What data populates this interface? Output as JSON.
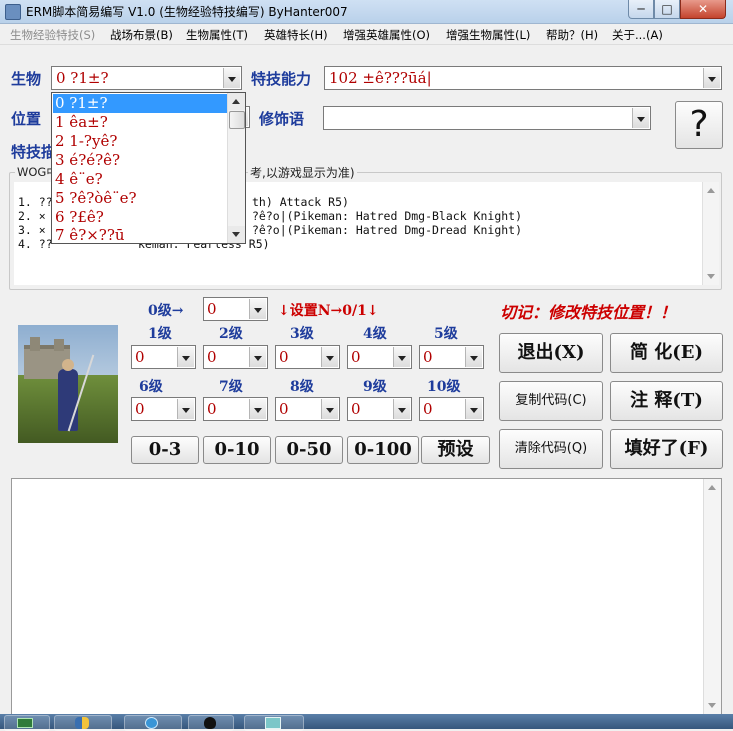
{
  "window": {
    "title": "ERM脚本简易编写 V1.0 (生物经验特技编写) ByHanter007",
    "min_glyph": "─",
    "max_glyph": "□",
    "close_glyph": "✕"
  },
  "menu": {
    "items": [
      {
        "label": "生物经验特技(S)",
        "disabled": true
      },
      {
        "label": "战场布景(B)"
      },
      {
        "label": "生物属性(T)"
      },
      {
        "label": "英雄特长(H)"
      },
      {
        "label": "增强英雄属性(O)"
      },
      {
        "label": "增强生物属性(L)"
      },
      {
        "label": "帮助？(H)"
      },
      {
        "label": "关于...(A)"
      }
    ]
  },
  "form": {
    "creature_label": "生物",
    "creature_value": "0 ?1±?",
    "ability_label": "特技能力",
    "ability_value": "102 ±ê???ūá|",
    "position_label": "位置",
    "modifier_label": "修饰语",
    "modifier_value": "",
    "skill_label": "特技描",
    "help_glyph": "?"
  },
  "creature_list": [
    {
      "text": "0 ?1±?",
      "selected": true
    },
    {
      "text": "1 êa±?"
    },
    {
      "text": "2 1-?yê?"
    },
    {
      "text": "3 é?é?ê?"
    },
    {
      "text": "4 ê¨e?"
    },
    {
      "text": "5 ?ê?òê¨e?"
    },
    {
      "text": "6 ?£ê?"
    },
    {
      "text": "7 ê?×??ū"
    }
  ],
  "description": {
    "legend_prefix": "WOG中",
    "legend_suffix": "考,以游戏显示为准)",
    "lines": [
      {
        "left": "1. ??",
        "right": "th) Attack R5)"
      },
      {
        "left": "2. ×",
        "right": "?ê?o|(Pikeman: Hatred Dmg-Black Knight)"
      },
      {
        "left": "3. ×",
        "right": "?ê?o|(Pikeman: Hatred Dmg-Dread Knight)"
      },
      {
        "left": "4. ??",
        "right": "keman: Fearless R5)"
      }
    ]
  },
  "levels": {
    "level0_label": "0级→",
    "level0_value": "0",
    "set_hint": "↓设置N→0/1↓",
    "warning": "切记：修改特技位置！！",
    "row1": [
      {
        "label": "1级",
        "value": "0"
      },
      {
        "label": "2级",
        "value": "0"
      },
      {
        "label": "3级",
        "value": "0"
      },
      {
        "label": "4级",
        "value": "0"
      },
      {
        "label": "5级",
        "value": "0"
      }
    ],
    "row2": [
      {
        "label": "6级",
        "value": "0"
      },
      {
        "label": "7级",
        "value": "0"
      },
      {
        "label": "8级",
        "value": "0"
      },
      {
        "label": "9级",
        "value": "0"
      },
      {
        "label": "10级",
        "value": "0"
      }
    ],
    "presets": [
      "0-3",
      "0-10",
      "0-50",
      "0-100",
      "预设"
    ]
  },
  "buttons": {
    "exit": "退出(X)",
    "simplify": "简 化(E)",
    "copy_code": "复制代码(C)",
    "comment": "注 释(T)",
    "clear_code": "清除代码(Q)",
    "done": "填好了(F)"
  },
  "output": {
    "text": ""
  },
  "colors": {
    "label_blue": "#1e3c9c",
    "value_red": "#b00000",
    "warning_red": "#cc0000",
    "selection_blue": "#3399ff"
  }
}
